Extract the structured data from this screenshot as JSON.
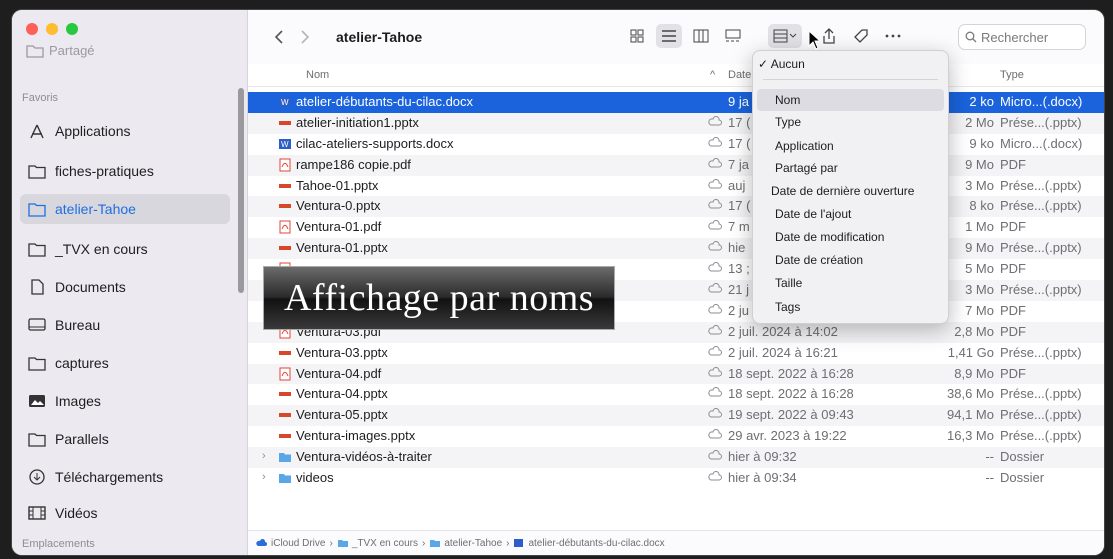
{
  "sidebar": {
    "shared_label": "Partagé",
    "favorites_label": "Favoris",
    "locations_label": "Emplacements",
    "items": [
      {
        "label": "Applications",
        "icon": "applications-icon"
      },
      {
        "label": "fiches-pratiques",
        "icon": "folder-icon"
      },
      {
        "label": "atelier-Tahoe",
        "icon": "folder-icon",
        "active": true
      },
      {
        "label": "_TVX en cours",
        "icon": "folder-icon"
      },
      {
        "label": "Documents",
        "icon": "document-icon"
      },
      {
        "label": "Bureau",
        "icon": "desktop-icon"
      },
      {
        "label": "captures",
        "icon": "folder-icon"
      },
      {
        "label": "Images",
        "icon": "photo-icon"
      },
      {
        "label": "Parallels",
        "icon": "folder-icon"
      },
      {
        "label": "Téléchargements",
        "icon": "download-icon"
      },
      {
        "label": "Vidéos",
        "icon": "film-icon"
      }
    ]
  },
  "toolbar": {
    "title": "atelier-Tahoe",
    "search_placeholder": "Rechercher"
  },
  "columns": {
    "name": "Nom",
    "date": "Date",
    "type": "Type"
  },
  "files": [
    {
      "name": "atelier-débutants-du-cilac.docx",
      "date": "9 ja",
      "size": "2 ko",
      "type": "Micro...(.docx)",
      "kind": "docx",
      "selected": true
    },
    {
      "name": "atelier-initiation1.pptx",
      "date": "17 (",
      "size": "2 Mo",
      "type": "Prése...(.pptx)",
      "kind": "pptx"
    },
    {
      "name": "cilac-ateliers-supports.docx",
      "date": "17 (",
      "size": "9 ko",
      "type": "Micro...(.docx)",
      "kind": "docx"
    },
    {
      "name": "rampe186 copie.pdf",
      "date": "7 ja",
      "size": "9 Mo",
      "type": "PDF",
      "kind": "pdf"
    },
    {
      "name": "Tahoe-01.pptx",
      "date": "auj",
      "size": "3 Mo",
      "type": "Prése...(.pptx)",
      "kind": "pptx"
    },
    {
      "name": "Ventura-0.pptx",
      "date": "17 (",
      "size": "8 ko",
      "type": "Prése...(.pptx)",
      "kind": "pptx"
    },
    {
      "name": "Ventura-01.pdf",
      "date": "7 m",
      "size": "1 Mo",
      "type": "PDF",
      "kind": "pdf"
    },
    {
      "name": "Ventura-01.pptx",
      "date": "hie",
      "size": "9 Mo",
      "type": "Prése...(.pptx)",
      "kind": "pptx"
    },
    {
      "name": "",
      "date": "13 ;",
      "size": "5 Mo",
      "type": "PDF",
      "kind": "pdf"
    },
    {
      "name": "",
      "date": "21 j",
      "size": "3 Mo",
      "type": "Prése...(.pptx)",
      "kind": "pptx"
    },
    {
      "name": "",
      "date": "2 ju",
      "size": "7 Mo",
      "type": "PDF",
      "kind": "pdf"
    },
    {
      "name": "Ventura-03.pdf",
      "date": "2 juil. 2024 à 14:02",
      "size": "2,8 Mo",
      "type": "PDF",
      "kind": "pdf"
    },
    {
      "name": "Ventura-03.pptx",
      "date": "2 juil. 2024 à 16:21",
      "size": "1,41 Go",
      "type": "Prése...(.pptx)",
      "kind": "pptx"
    },
    {
      "name": "Ventura-04.pdf",
      "date": "18 sept. 2022 à 16:28",
      "size": "8,9 Mo",
      "type": "PDF",
      "kind": "pdf"
    },
    {
      "name": "Ventura-04.pptx",
      "date": "18 sept. 2022 à 16:28",
      "size": "38,6 Mo",
      "type": "Prése...(.pptx)",
      "kind": "pptx"
    },
    {
      "name": "Ventura-05.pptx",
      "date": "19 sept. 2022 à 09:43",
      "size": "94,1 Mo",
      "type": "Prése...(.pptx)",
      "kind": "pptx"
    },
    {
      "name": "Ventura-images.pptx",
      "date": "29 avr. 2023 à 19:22",
      "size": "16,3 Mo",
      "type": "Prése...(.pptx)",
      "kind": "pptx"
    },
    {
      "name": "Ventura-vidéos-à-traiter",
      "date": "hier à 09:32",
      "size": "--",
      "type": "Dossier",
      "kind": "folder"
    },
    {
      "name": "videos",
      "date": "hier à 09:34",
      "size": "--",
      "type": "Dossier",
      "kind": "folder"
    }
  ],
  "dropdown": {
    "checked": "Aucun",
    "items": [
      "Nom",
      "Type",
      "Application",
      "Partagé par",
      "Date de dernière ouverture",
      "Date de l'ajout",
      "Date de modification",
      "Date de création",
      "Taille",
      "Tags"
    ]
  },
  "caption": "Affichage par noms",
  "pathbar": [
    "iCloud Drive",
    "_TVX en cours",
    "atelier-Tahoe",
    "atelier-débutants-du-cilac.docx"
  ],
  "colors": {
    "accent": "#1a63dc",
    "pptx": "#d9472b",
    "pdf": "#e0463b",
    "folder": "#5aa7e8"
  }
}
